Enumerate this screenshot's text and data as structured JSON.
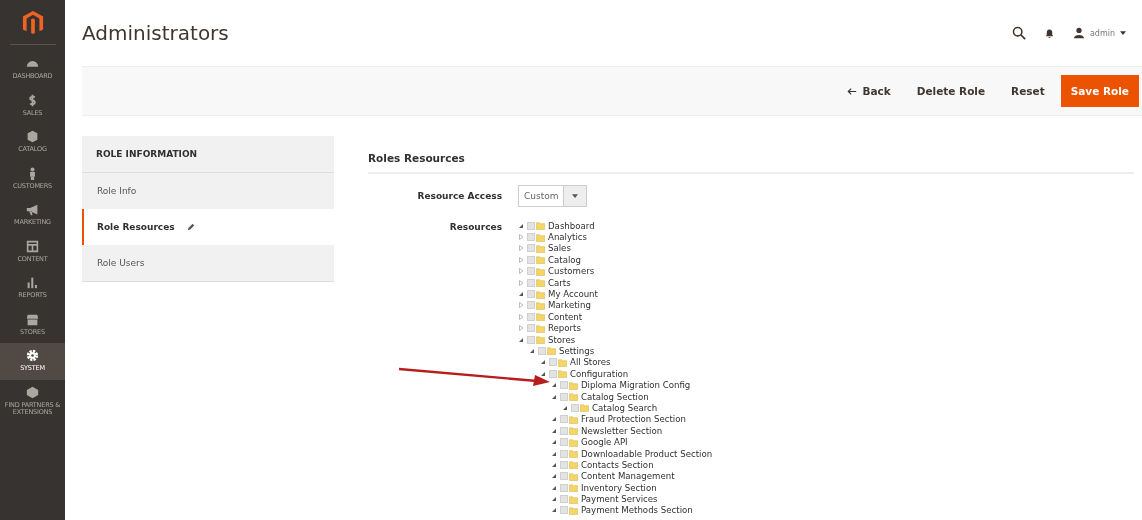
{
  "sidebar": {
    "items": [
      {
        "label": "DASHBOARD",
        "kind": "gauge",
        "selected": false
      },
      {
        "label": "SALES",
        "kind": "dollar",
        "selected": false
      },
      {
        "label": "CATALOG",
        "kind": "box",
        "selected": false
      },
      {
        "label": "CUSTOMERS",
        "kind": "person",
        "selected": false
      },
      {
        "label": "MARKETING",
        "kind": "megaphone",
        "selected": false
      },
      {
        "label": "CONTENT",
        "kind": "layout",
        "selected": false
      },
      {
        "label": "REPORTS",
        "kind": "bars",
        "selected": false
      },
      {
        "label": "STORES",
        "kind": "store",
        "selected": false
      },
      {
        "label": "SYSTEM",
        "kind": "gear",
        "selected": true
      },
      {
        "label": "FIND PARTNERS & EXTENSIONS",
        "kind": "cube",
        "selected": false
      }
    ]
  },
  "page_title": "Administrators",
  "header": {
    "user": "admin"
  },
  "actions": [
    {
      "label": "Back",
      "kind": "back"
    },
    {
      "label": "Delete Role",
      "kind": "plain"
    },
    {
      "label": "Reset",
      "kind": "plain"
    },
    {
      "label": "Save Role",
      "kind": "primary"
    }
  ],
  "role_information": {
    "title": "ROLE INFORMATION",
    "tabs": [
      {
        "label": "Role Info",
        "selected": false
      },
      {
        "label": "Role Resources",
        "selected": true
      },
      {
        "label": "Role Users",
        "selected": false
      }
    ]
  },
  "roles_resources": {
    "title": "Roles Resources",
    "resource_access": {
      "label": "Resource Access",
      "value": "Custom"
    },
    "resources_label": "Resources",
    "tree": [
      {
        "label": "Dashboard",
        "expanded": true,
        "checked": false
      },
      {
        "label": "Analytics",
        "expanded": false,
        "checked": false
      },
      {
        "label": "Sales",
        "expanded": false,
        "checked": false
      },
      {
        "label": "Catalog",
        "expanded": false,
        "checked": false
      },
      {
        "label": "Customers",
        "expanded": false,
        "checked": false
      },
      {
        "label": "Carts",
        "expanded": false,
        "checked": false
      },
      {
        "label": "My Account",
        "expanded": true,
        "checked": false
      },
      {
        "label": "Marketing",
        "expanded": false,
        "checked": false
      },
      {
        "label": "Content",
        "expanded": false,
        "checked": false
      },
      {
        "label": "Reports",
        "expanded": false,
        "checked": false
      },
      {
        "label": "Stores",
        "expanded": true,
        "checked": false,
        "children": [
          {
            "label": "Settings",
            "expanded": true,
            "checked": false,
            "children": [
              {
                "label": "All Stores",
                "expanded": true,
                "checked": false
              },
              {
                "label": "Configuration",
                "expanded": true,
                "checked": false,
                "children": [
                  {
                    "label": "Diploma Migration Config",
                    "expanded": true,
                    "checked": false,
                    "highlighted": true
                  },
                  {
                    "label": "Catalog Section",
                    "expanded": true,
                    "checked": false,
                    "children": [
                      {
                        "label": "Catalog Search",
                        "expanded": true,
                        "checked": false
                      }
                    ]
                  },
                  {
                    "label": "Fraud Protection Section",
                    "expanded": true,
                    "checked": false
                  },
                  {
                    "label": "Newsletter Section",
                    "expanded": true,
                    "checked": false
                  },
                  {
                    "label": "Google API",
                    "expanded": true,
                    "checked": false
                  },
                  {
                    "label": "Downloadable Product Section",
                    "expanded": true,
                    "checked": false
                  },
                  {
                    "label": "Contacts Section",
                    "expanded": true,
                    "checked": false
                  },
                  {
                    "label": "Content Management",
                    "expanded": true,
                    "checked": false
                  },
                  {
                    "label": "Inventory Section",
                    "expanded": true,
                    "checked": false
                  },
                  {
                    "label": "Payment Services",
                    "expanded": true,
                    "checked": false
                  },
                  {
                    "label": "Payment Methods Section",
                    "expanded": true,
                    "checked": false
                  }
                ]
              }
            ]
          }
        ]
      }
    ]
  }
}
